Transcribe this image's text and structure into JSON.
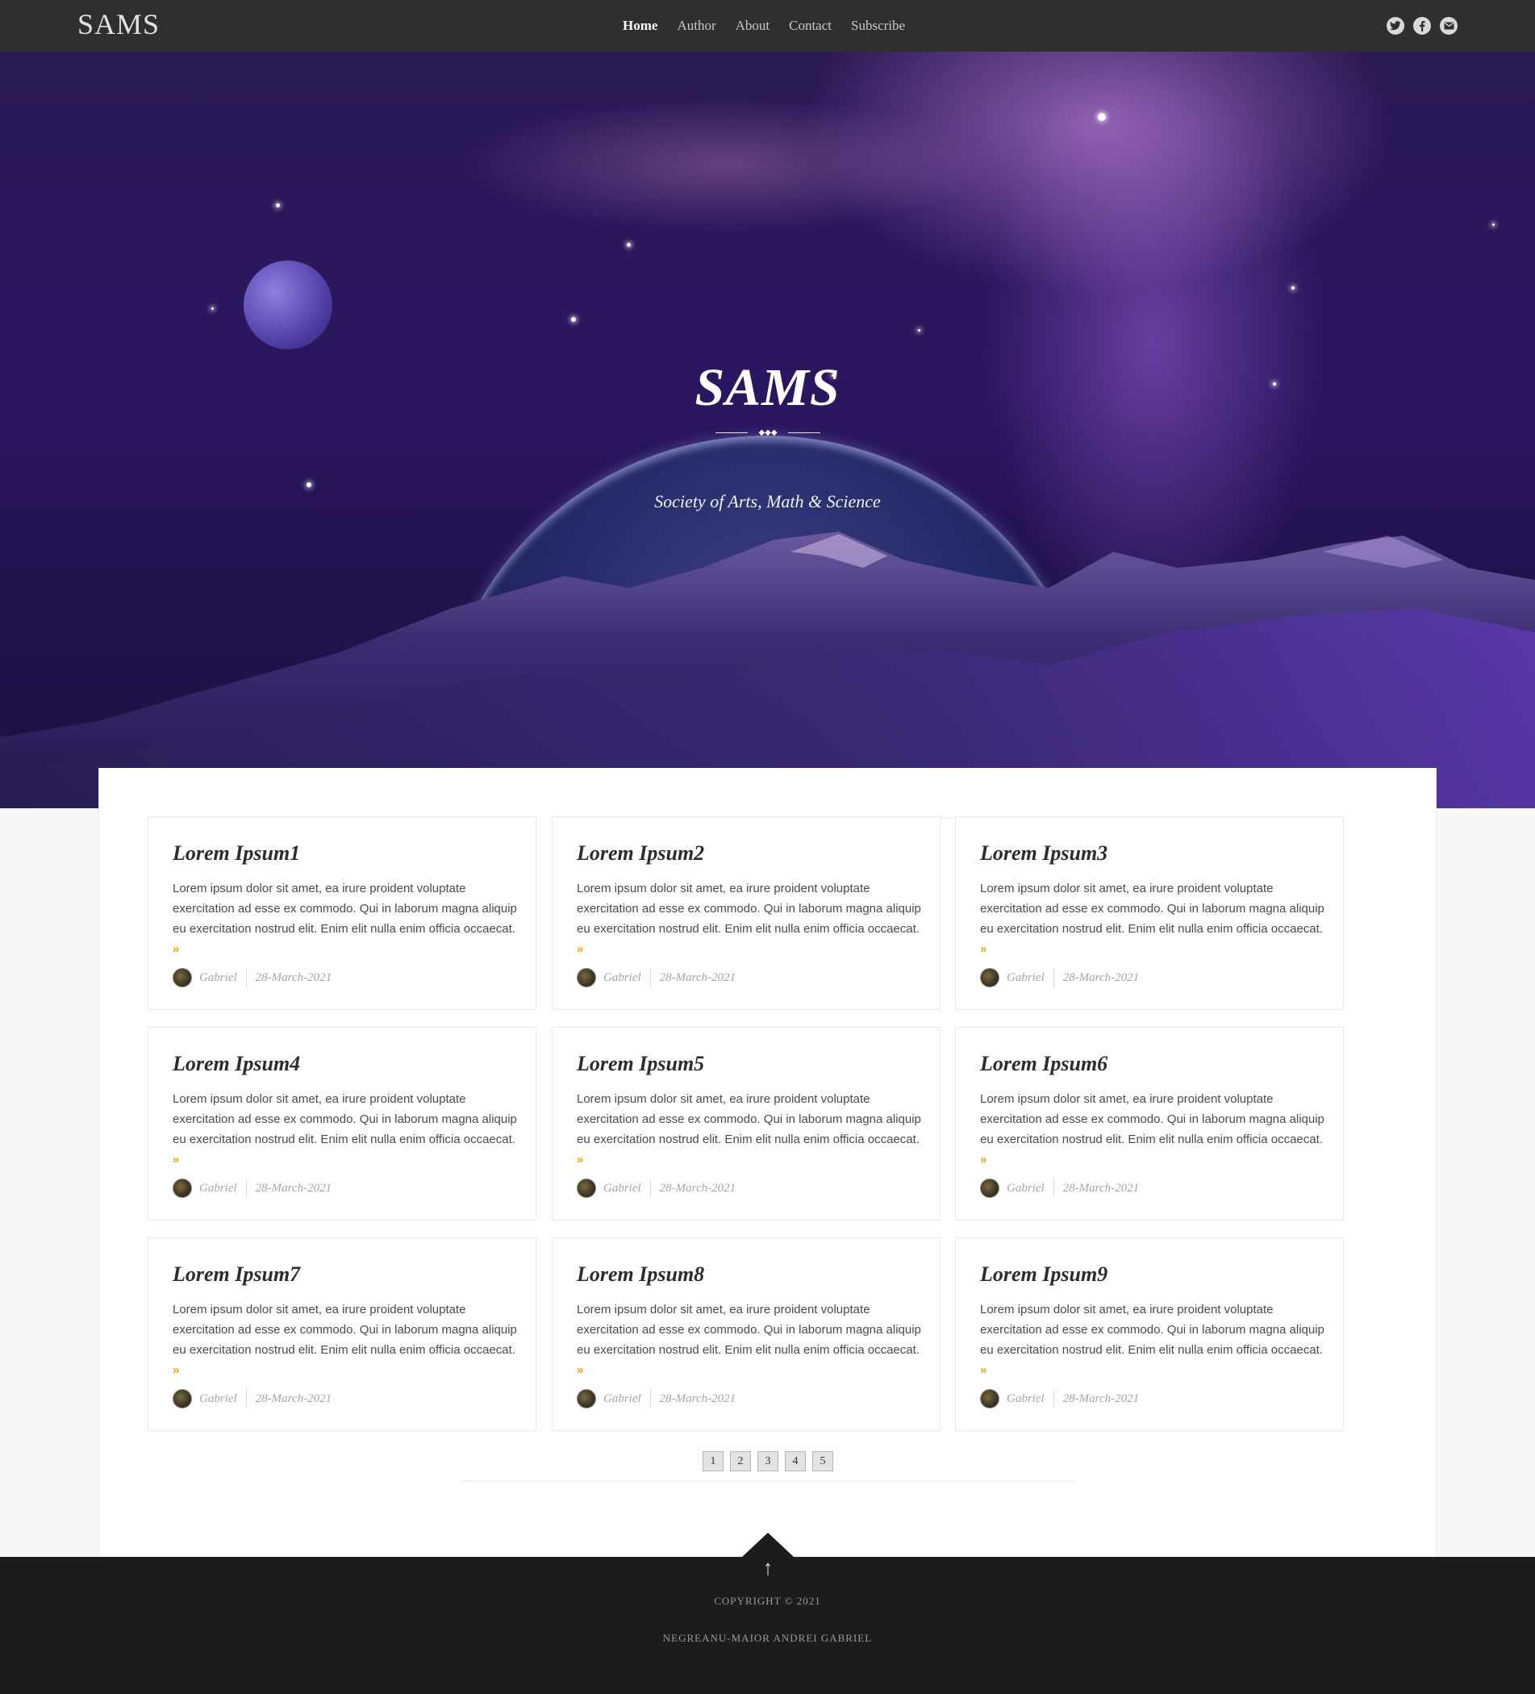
{
  "nav": {
    "logo": "SAMS",
    "items": [
      {
        "label": "Home",
        "active": true
      },
      {
        "label": "Author",
        "active": false
      },
      {
        "label": "About",
        "active": false
      },
      {
        "label": "Contact",
        "active": false
      },
      {
        "label": "Subscribe",
        "active": false
      }
    ],
    "social": [
      "twitter-icon",
      "facebook-icon",
      "email-icon"
    ]
  },
  "hero": {
    "title": "SAMS",
    "ornament": "◆◆◆",
    "subtitle": "Society of Arts, Math & Science"
  },
  "posts": [
    {
      "title": "Lorem Ipsum1",
      "excerpt": "Lorem ipsum dolor sit amet, ea irure proident voluptate exercitation ad esse ex commodo. Qui in laborum magna aliquip eu exercitation nostrud elit. Enim elit nulla enim officia occaecat.",
      "more": "»",
      "author": "Gabriel",
      "date": "28-March-2021"
    },
    {
      "title": "Lorem Ipsum2",
      "excerpt": "Lorem ipsum dolor sit amet, ea irure proident voluptate exercitation ad esse ex commodo. Qui in laborum magna aliquip eu exercitation nostrud elit. Enim elit nulla enim officia occaecat.",
      "more": "»",
      "author": "Gabriel",
      "date": "28-March-2021"
    },
    {
      "title": "Lorem Ipsum3",
      "excerpt": "Lorem ipsum dolor sit amet, ea irure proident voluptate exercitation ad esse ex commodo. Qui in laborum magna aliquip eu exercitation nostrud elit. Enim elit nulla enim officia occaecat.",
      "more": "»",
      "author": "Gabriel",
      "date": "28-March-2021"
    },
    {
      "title": "Lorem Ipsum4",
      "excerpt": "Lorem ipsum dolor sit amet, ea irure proident voluptate exercitation ad esse ex commodo. Qui in laborum magna aliquip eu exercitation nostrud elit. Enim elit nulla enim officia occaecat.",
      "more": "»",
      "author": "Gabriel",
      "date": "28-March-2021"
    },
    {
      "title": "Lorem Ipsum5",
      "excerpt": "Lorem ipsum dolor sit amet, ea irure proident voluptate exercitation ad esse ex commodo. Qui in laborum magna aliquip eu exercitation nostrud elit. Enim elit nulla enim officia occaecat.",
      "more": "»",
      "author": "Gabriel",
      "date": "28-March-2021"
    },
    {
      "title": "Lorem Ipsum6",
      "excerpt": "Lorem ipsum dolor sit amet, ea irure proident voluptate exercitation ad esse ex commodo. Qui in laborum magna aliquip eu exercitation nostrud elit. Enim elit nulla enim officia occaecat.",
      "more": "»",
      "author": "Gabriel",
      "date": "28-March-2021"
    },
    {
      "title": "Lorem Ipsum7",
      "excerpt": "Lorem ipsum dolor sit amet, ea irure proident voluptate exercitation ad esse ex commodo. Qui in laborum magna aliquip eu exercitation nostrud elit. Enim elit nulla enim officia occaecat.",
      "more": "»",
      "author": "Gabriel",
      "date": "28-March-2021"
    },
    {
      "title": "Lorem Ipsum8",
      "excerpt": "Lorem ipsum dolor sit amet, ea irure proident voluptate exercitation ad esse ex commodo. Qui in laborum magna aliquip eu exercitation nostrud elit. Enim elit nulla enim officia occaecat.",
      "more": "»",
      "author": "Gabriel",
      "date": "28-March-2021"
    },
    {
      "title": "Lorem Ipsum9",
      "excerpt": "Lorem ipsum dolor sit amet, ea irure proident voluptate exercitation ad esse ex commodo. Qui in laborum magna aliquip eu exercitation nostrud elit. Enim elit nulla enim officia occaecat.",
      "more": "»",
      "author": "Gabriel",
      "date": "28-March-2021"
    }
  ],
  "pagination": [
    "1",
    "2",
    "3",
    "4",
    "5"
  ],
  "footer": {
    "to_top": "↑",
    "copyright": "COPYRIGHT © 2021",
    "maker": "NEGREANU-MAIOR ANDREI GABRIEL"
  }
}
